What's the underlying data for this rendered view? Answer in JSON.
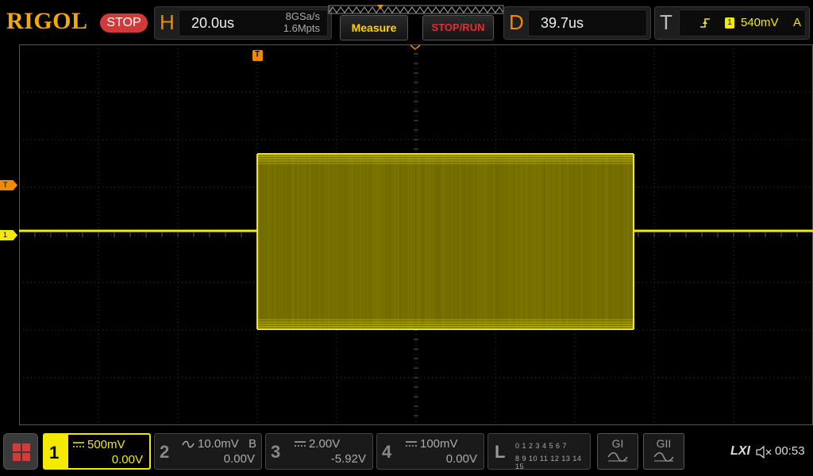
{
  "brand": {
    "logo_text": "RIGOL",
    "run_state": "STOP"
  },
  "horizontal": {
    "letter": "H",
    "timebase": "20.0us",
    "sample_rate": "8GSa/s",
    "memory_depth": "1.6Mpts"
  },
  "buttons": {
    "measure": "Measure",
    "stop_run": "STOP/RUN"
  },
  "delay": {
    "letter": "D",
    "value": "39.7us"
  },
  "trigger": {
    "letter": "T",
    "source_badge": "1",
    "level": "540mV",
    "mode": "A"
  },
  "markers": {
    "trigger_level": "T",
    "channel1": "1",
    "trigger_position": "T"
  },
  "channels": [
    {
      "num": "1",
      "coupling_icon": "dc-icon",
      "scale": "500mV",
      "offset": "0.00V",
      "active": true
    },
    {
      "num": "2",
      "coupling_icon": "ac-icon",
      "scale": "10.0mV",
      "bw_flag": "B",
      "offset": "0.00V",
      "active": false
    },
    {
      "num": "3",
      "coupling_icon": "dc-icon",
      "scale": "2.00V",
      "offset": "-5.92V",
      "active": false
    },
    {
      "num": "4",
      "coupling_icon": "dc-icon",
      "scale": "100mV",
      "offset": "0.00V",
      "active": false
    }
  ],
  "logic": {
    "letter": "L",
    "row1": "0 1 2 3   4 5 6 7",
    "row2": "8 9 10 11 12 13 14 15"
  },
  "decoders": [
    {
      "label": "GI"
    },
    {
      "label": "GII"
    }
  ],
  "status": {
    "lxi": "LXI",
    "time": "00:53"
  },
  "colors": {
    "ch1": "#f3ea00",
    "accent": "#f08a00",
    "stop": "#d23a3a",
    "grid": "#3a3a3a"
  },
  "waveform": {
    "channel": "1",
    "burst_start_div": 3.0,
    "burst_end_div": 7.74,
    "baseline_div": 4.0,
    "burst_high_div": 2.5,
    "burst_low_div": 6.2,
    "h_divisions": 10,
    "v_divisions": 8
  }
}
